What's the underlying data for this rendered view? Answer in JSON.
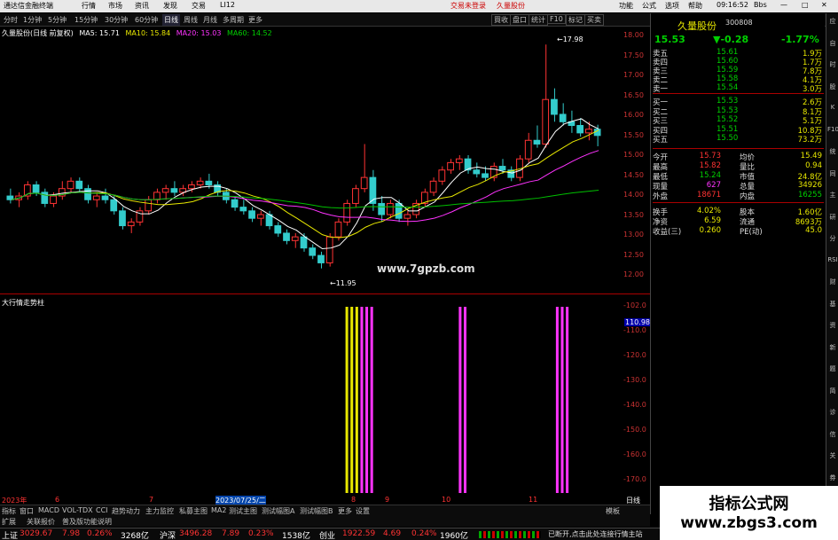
{
  "titlebar": {
    "app_name": "通达信金融终端",
    "menus": [
      "行情",
      "市场",
      "资讯",
      "发现",
      "交易",
      "LI12"
    ],
    "center_links": [
      "交易未登录",
      "久量股份"
    ],
    "right_items": [
      "功能",
      "公式",
      "选项",
      "帮助",
      "09:16:52",
      "Bbs"
    ]
  },
  "period_tabs": [
    "分时",
    "1分钟",
    "5分钟",
    "15分钟",
    "30分钟",
    "60分钟",
    "日线",
    "周线",
    "月线",
    "多周期",
    "更多"
  ],
  "active_period": "日线",
  "toolbar_buttons": [
    "買收",
    "盘口",
    "统计",
    "F10",
    "标记",
    "买卖"
  ],
  "main_legend": {
    "name": "久量股份(日线 前复权)",
    "ma5": "MA5: 15.71",
    "ma10": "MA10: 15.84",
    "ma20": "MA20: 15.03",
    "ma60": "MA60: 14.52"
  },
  "high_label": "17.98",
  "low_label": "11.95",
  "site_watermark": "www.7gpzb.com",
  "indicator_legend": "大行情走势柱",
  "indicator_current": "110.98",
  "yaxis_main": [
    "18.00",
    "17.50",
    "17.00",
    "16.50",
    "16.00",
    "15.50",
    "15.00",
    "14.50",
    "14.00",
    "13.50",
    "13.00",
    "12.50",
    "12.00"
  ],
  "yaxis_ind": [
    "102.0",
    "110.0",
    "120.0",
    "130.0",
    "140.0",
    "150.0",
    "160.0",
    "170.0"
  ],
  "date_axis": [
    "2023年",
    "6",
    "7",
    "2023/07/25/二",
    "8",
    "9",
    "10",
    "11",
    "日线"
  ],
  "bottom_tabs": [
    "指标",
    "窗口",
    "MACD",
    "VOL-TDX",
    "CCI",
    "趋势动力",
    "主力监控",
    "私募主图",
    "MA2",
    "测试主图",
    "测试幅图A",
    "测试幅图B",
    "更多",
    "设置",
    "模板"
  ],
  "bottom_tabs2": [
    "扩展",
    "关联报价",
    "普及版功能说明"
  ],
  "stock": {
    "name": "久量股份",
    "code": "300808",
    "price": "15.53",
    "change": "▼-0.28",
    "pct": "-1.77%"
  },
  "asks": [
    {
      "label": "卖五",
      "price": "15.61",
      "vol": "1.9万"
    },
    {
      "label": "卖四",
      "price": "15.60",
      "vol": "1.7万"
    },
    {
      "label": "卖三",
      "price": "15.59",
      "vol": "7.8万"
    },
    {
      "label": "卖二",
      "price": "15.58",
      "vol": "4.1万"
    },
    {
      "label": "卖一",
      "price": "15.54",
      "vol": "3.0万"
    }
  ],
  "bids": [
    {
      "label": "买一",
      "price": "15.53",
      "vol": "2.6万"
    },
    {
      "label": "买二",
      "price": "15.53",
      "vol": "8.1万"
    },
    {
      "label": "买三",
      "price": "15.52",
      "vol": "5.1万"
    },
    {
      "label": "买四",
      "price": "15.51",
      "vol": "10.8万"
    },
    {
      "label": "买五",
      "price": "15.50",
      "vol": "73.2万"
    }
  ],
  "stats": [
    {
      "l1": "今开",
      "v1": "15.73",
      "l2": "均价",
      "v2": "15.49"
    },
    {
      "l1": "最高",
      "v1": "15.82",
      "l2": "量比",
      "v2": "0.94"
    },
    {
      "l1": "最低",
      "v1": "15.24",
      "l2": "市值",
      "v2": "24.8亿"
    },
    {
      "l1": "现量",
      "v1": "627",
      "l2": "总量",
      "v2": "34926"
    },
    {
      "l1": "外盘",
      "v1": "18671",
      "l2": "内盘",
      "v2": "16255"
    }
  ],
  "fund": [
    {
      "l1": "换手",
      "v1": "4.02%",
      "l2": "股本",
      "v2": "1.60亿"
    },
    {
      "l1": "净资",
      "v1": "6.59",
      "l2": "流通",
      "v2": "8693万"
    },
    {
      "l1": "收益(三)",
      "v1": "0.260",
      "l2": "PE(动)",
      "v2": "45.0"
    }
  ],
  "sidebar": [
    "应",
    "自",
    "时",
    "股",
    "K",
    "F10",
    "统",
    "同",
    "主",
    "研",
    "分",
    "RSI",
    "财",
    "基",
    "资",
    "新",
    "题",
    "简",
    "诊",
    "信",
    "关",
    "券"
  ],
  "statusbar": {
    "idx1_name": "上证",
    "idx1_val": "3029.67",
    "idx1_chg": "7.98",
    "idx1_pct": "0.26%",
    "idx1_amt": "3268亿",
    "idx2_name": "沪深",
    "idx2_val": "3496.28",
    "idx2_chg": "7.89",
    "idx2_pct": "0.23%",
    "idx2_amt": "1538亿",
    "idx3_name": "创业",
    "idx3_val": "1922.59",
    "idx3_chg": "4.69",
    "idx3_pct": "0.24%",
    "idx3_amt": "1960亿",
    "notice": "已断开,点击此处连接行情主站"
  },
  "watermark": {
    "line1": "指标公式网",
    "line2": "www.zbgs3.com"
  },
  "chart_data": {
    "type": "candlestick",
    "ylim": [
      11.8,
      18.2
    ],
    "candles": [
      [
        13.9,
        14.1,
        13.7,
        13.8
      ],
      [
        13.8,
        14.0,
        13.6,
        13.9
      ],
      [
        13.9,
        14.3,
        13.8,
        14.2
      ],
      [
        14.2,
        14.3,
        13.9,
        14.0
      ],
      [
        14.0,
        14.1,
        13.6,
        13.7
      ],
      [
        13.7,
        14.0,
        13.6,
        13.9
      ],
      [
        13.9,
        14.3,
        13.8,
        14.1
      ],
      [
        14.1,
        14.4,
        14.0,
        14.3
      ],
      [
        14.3,
        14.4,
        14.0,
        14.1
      ],
      [
        14.1,
        14.2,
        13.7,
        13.8
      ],
      [
        13.8,
        14.0,
        13.6,
        13.9
      ],
      [
        13.9,
        14.1,
        13.7,
        13.8
      ],
      [
        13.8,
        13.9,
        13.4,
        13.5
      ],
      [
        13.5,
        13.6,
        13.0,
        13.1
      ],
      [
        13.1,
        13.3,
        12.9,
        13.2
      ],
      [
        13.2,
        13.6,
        13.1,
        13.5
      ],
      [
        13.5,
        13.9,
        13.4,
        13.8
      ],
      [
        13.8,
        14.1,
        13.7,
        14.0
      ],
      [
        14.0,
        14.2,
        13.8,
        14.1
      ],
      [
        14.1,
        14.3,
        13.9,
        14.0
      ],
      [
        14.0,
        14.2,
        13.9,
        14.1
      ],
      [
        14.1,
        14.3,
        14.0,
        14.2
      ],
      [
        14.2,
        14.4,
        14.1,
        14.3
      ],
      [
        14.3,
        14.5,
        14.1,
        14.2
      ],
      [
        14.2,
        14.3,
        13.9,
        14.0
      ],
      [
        14.0,
        14.1,
        13.7,
        13.8
      ],
      [
        13.8,
        13.9,
        13.5,
        13.6
      ],
      [
        13.6,
        13.8,
        13.4,
        13.5
      ],
      [
        13.5,
        13.6,
        13.2,
        13.3
      ],
      [
        13.3,
        13.5,
        13.1,
        13.4
      ],
      [
        13.4,
        13.5,
        13.0,
        13.1
      ],
      [
        13.1,
        13.2,
        12.8,
        12.9
      ],
      [
        12.9,
        13.0,
        12.6,
        12.7
      ],
      [
        12.7,
        12.9,
        12.5,
        12.8
      ],
      [
        12.8,
        12.9,
        12.4,
        12.5
      ],
      [
        12.5,
        12.6,
        12.2,
        12.3
      ],
      [
        12.3,
        12.4,
        11.95,
        12.1
      ],
      [
        12.1,
        12.9,
        12.0,
        12.8
      ],
      [
        12.8,
        13.3,
        12.7,
        13.2
      ],
      [
        13.2,
        13.8,
        13.1,
        13.7
      ],
      [
        13.7,
        14.2,
        13.6,
        14.1
      ],
      [
        14.1,
        15.3,
        14.0,
        14.4
      ],
      [
        14.4,
        14.6,
        13.5,
        13.7
      ],
      [
        13.7,
        13.9,
        13.2,
        13.4
      ],
      [
        13.4,
        13.8,
        13.3,
        13.7
      ],
      [
        13.7,
        13.8,
        13.2,
        13.3
      ],
      [
        13.3,
        13.5,
        13.1,
        13.4
      ],
      [
        13.4,
        13.8,
        13.3,
        13.7
      ],
      [
        13.7,
        14.1,
        13.6,
        14.0
      ],
      [
        14.0,
        14.4,
        13.9,
        14.3
      ],
      [
        14.3,
        14.7,
        14.2,
        14.6
      ],
      [
        14.6,
        14.9,
        14.5,
        14.8
      ],
      [
        14.8,
        15.0,
        14.6,
        14.9
      ],
      [
        14.9,
        15.0,
        14.5,
        14.6
      ],
      [
        14.6,
        14.8,
        14.4,
        14.5
      ],
      [
        14.5,
        14.7,
        14.3,
        14.4
      ],
      [
        14.4,
        14.8,
        14.3,
        14.7
      ],
      [
        14.7,
        14.9,
        14.5,
        14.6
      ],
      [
        14.6,
        14.7,
        14.3,
        14.4
      ],
      [
        14.4,
        15.0,
        14.3,
        14.9
      ],
      [
        14.9,
        15.6,
        14.8,
        15.4
      ],
      [
        15.4,
        15.8,
        15.2,
        15.3
      ],
      [
        15.3,
        17.98,
        15.2,
        16.5
      ],
      [
        16.5,
        16.8,
        15.9,
        16.1
      ],
      [
        16.1,
        16.4,
        15.8,
        15.9
      ],
      [
        15.9,
        16.2,
        15.6,
        15.8
      ],
      [
        15.8,
        16.0,
        15.5,
        15.6
      ],
      [
        15.6,
        15.9,
        15.4,
        15.7
      ],
      [
        15.7,
        15.82,
        15.24,
        15.53
      ]
    ],
    "bars": [
      {
        "pos": 0.555,
        "color": "#e8e800"
      },
      {
        "pos": 0.563,
        "color": "#e8e800"
      },
      {
        "pos": 0.571,
        "color": "#e8e800"
      },
      {
        "pos": 0.579,
        "color": "#ff33ff"
      },
      {
        "pos": 0.587,
        "color": "#ff33ff"
      },
      {
        "pos": 0.595,
        "color": "#ff33ff"
      },
      {
        "pos": 0.737,
        "color": "#ff33ff"
      },
      {
        "pos": 0.745,
        "color": "#ff33ff"
      },
      {
        "pos": 0.893,
        "color": "#ff33ff"
      },
      {
        "pos": 0.901,
        "color": "#ff33ff"
      },
      {
        "pos": 0.909,
        "color": "#ff33ff"
      }
    ]
  }
}
